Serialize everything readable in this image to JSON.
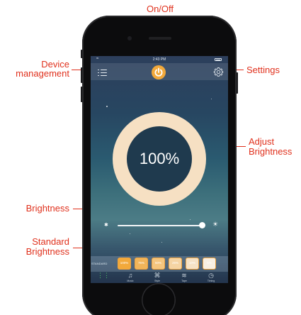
{
  "annotations": {
    "onoff": "On/Off",
    "device_line1": "Device",
    "device_line2": "management",
    "settings": "Settings",
    "adjust_line1": "Adjust",
    "adjust_line2": "Brightness",
    "brightness": "Brightness",
    "standard_line1": "Standard",
    "standard_line2": "Brightness"
  },
  "app": {
    "status_time": "2:43 PM",
    "brightness_value": "100%",
    "brightness_level": 1.0,
    "standard_label": "STANDARD",
    "presets": [
      "100%",
      "75%",
      "50%",
      "25%",
      "10%",
      "5%"
    ],
    "preset_fills": [
      "#f2a93b",
      "#f2b55a",
      "#f4c57e",
      "#f5d4a3",
      "#f6e2c6",
      "#f8efe2"
    ],
    "tabs": [
      {
        "icon": "sliders-icon",
        "label": ""
      },
      {
        "icon": "music-icon",
        "label": "Music"
      },
      {
        "icon": "style-icon",
        "label": "Style"
      },
      {
        "icon": "tape-icon",
        "label": "Tape"
      },
      {
        "icon": "timer-icon",
        "label": "Timing"
      }
    ]
  },
  "colors": {
    "annotation": "#e0311d",
    "accent": "#f2a93b",
    "ring": "#f6e0c3",
    "active_tab": "#4ec76a"
  }
}
